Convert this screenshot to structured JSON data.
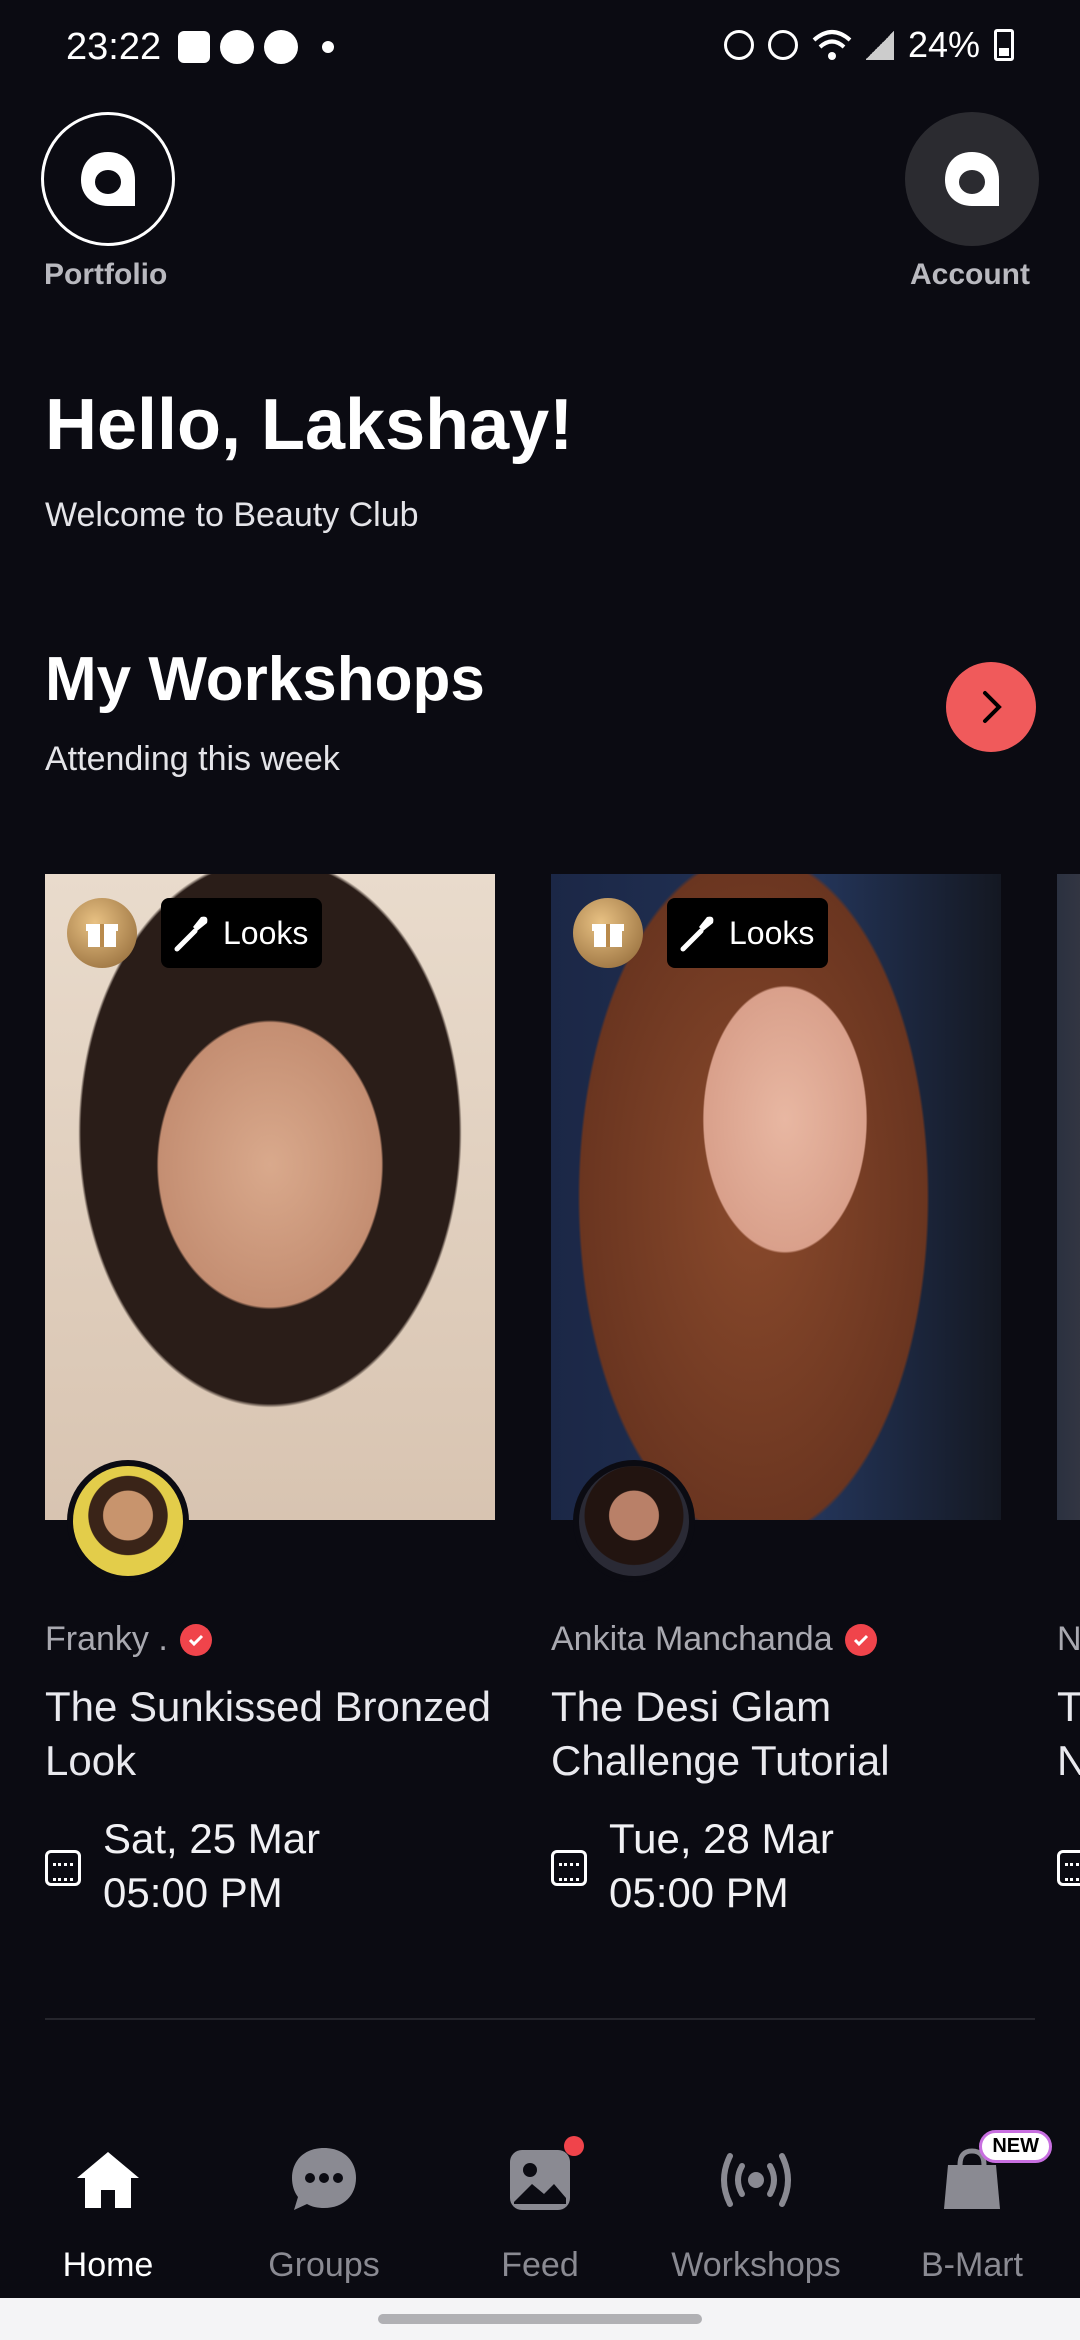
{
  "status_bar": {
    "time": "23:22",
    "battery": "24%"
  },
  "header": {
    "portfolio_label": "Portfolio",
    "account_label": "Account"
  },
  "greeting": {
    "title": "Hello, Lakshay!",
    "subtitle": "Welcome to Beauty Club"
  },
  "workshops": {
    "title": "My Workshops",
    "subtitle": "Attending this week",
    "cards": [
      {
        "badge": "Looks",
        "host": "Franky .",
        "title": "The Sunkissed Bronzed Look",
        "date": "Sat, 25 Mar",
        "time": "05:00 PM"
      },
      {
        "badge": "Looks",
        "host": "Ankita Manchanda",
        "title": "The Desi Glam Challenge Tutorial",
        "date": "Tue, 28 Mar",
        "time": "05:00 PM"
      },
      {
        "badge": "",
        "host": "N",
        "title": "T\nN",
        "date": "",
        "time": ""
      }
    ]
  },
  "nav": {
    "items": [
      {
        "label": "Home",
        "icon": "home-icon"
      },
      {
        "label": "Groups",
        "icon": "chat-bubble-icon"
      },
      {
        "label": "Feed",
        "icon": "image-icon"
      },
      {
        "label": "Workshops",
        "icon": "broadcast-icon"
      },
      {
        "label": "B-Mart",
        "icon": "shopping-bag-icon"
      }
    ],
    "new_badge": "NEW"
  }
}
